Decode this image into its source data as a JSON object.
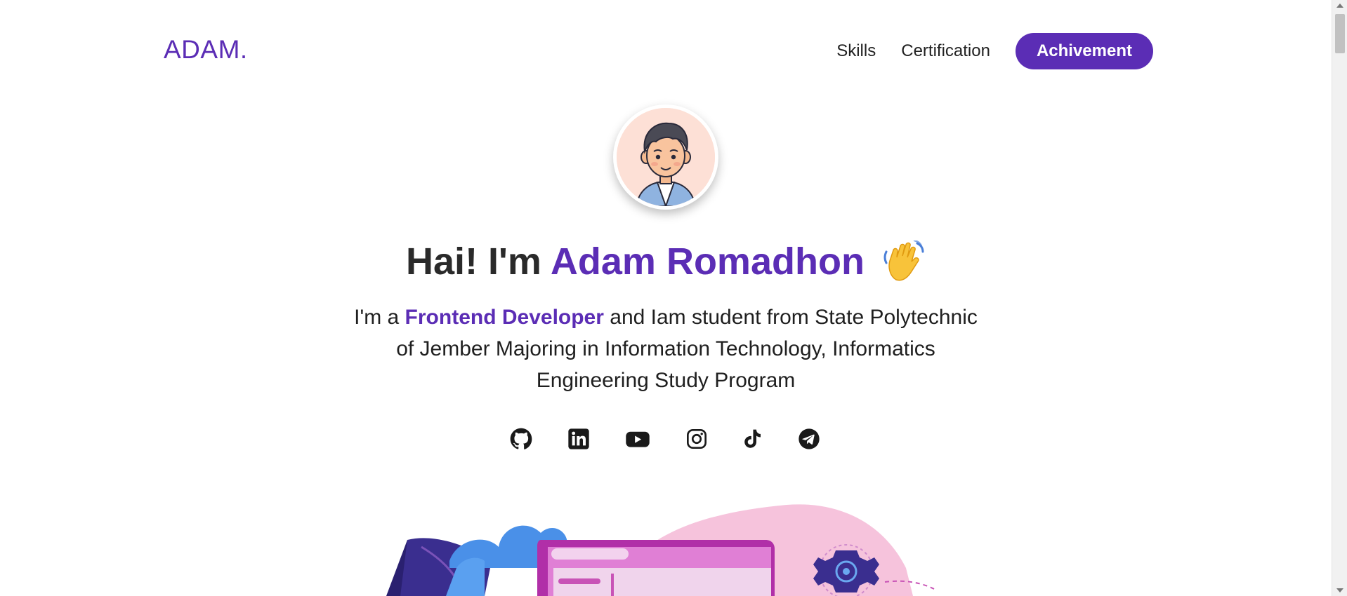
{
  "nav": {
    "logo": "ADAM.",
    "links": [
      {
        "label": "Skills"
      },
      {
        "label": "Certification"
      }
    ],
    "cta_label": "Achivement"
  },
  "hero": {
    "greeting": "Hai! I'm",
    "name": "Adam Romadhon",
    "wave_icon": "waving-hand-icon",
    "desc_prefix": "I'm a",
    "role": "Frontend Developer",
    "desc_suffix": "and Iam student from State Polytechnic of Jember Majoring in Information Technology, Informatics Engineering Study Program"
  },
  "socials": [
    {
      "icon": "github-icon"
    },
    {
      "icon": "linkedin-icon"
    },
    {
      "icon": "youtube-icon"
    },
    {
      "icon": "instagram-icon"
    },
    {
      "icon": "tiktok-icon"
    },
    {
      "icon": "telegram-icon"
    }
  ],
  "colors": {
    "accent": "#5b2db5",
    "text": "#222222",
    "avatar_bg": "#fde0d6"
  }
}
